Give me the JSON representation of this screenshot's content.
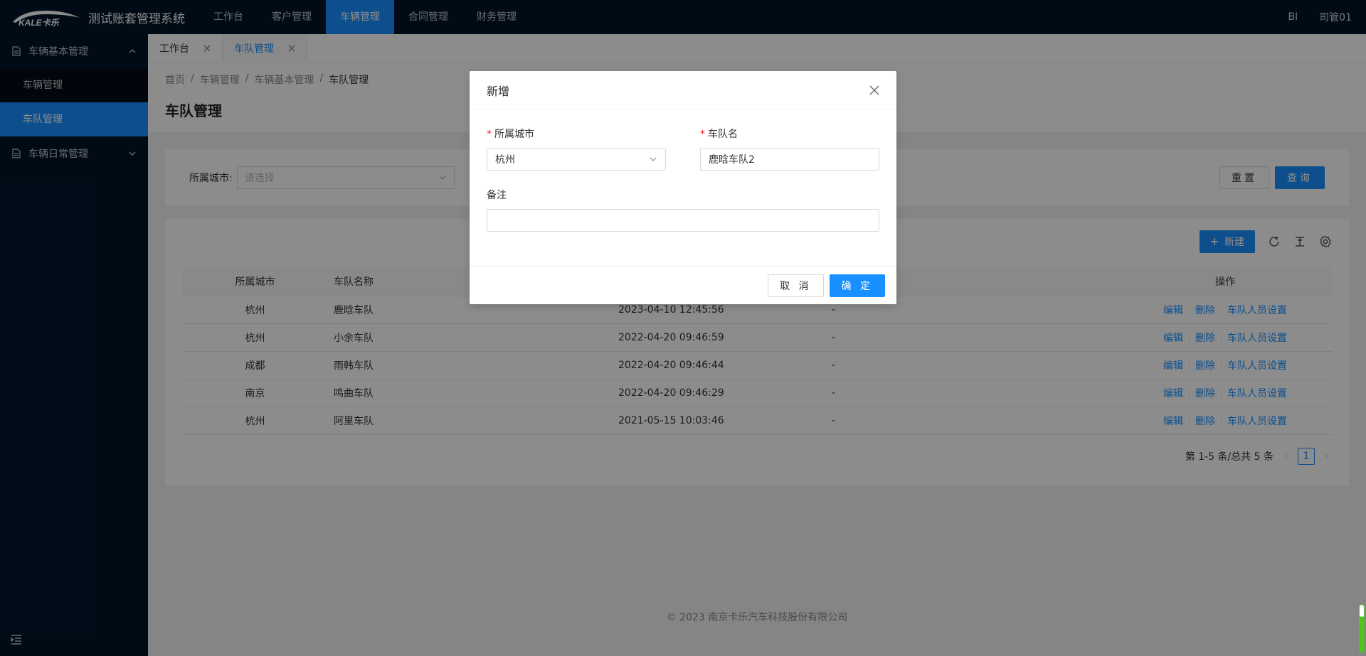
{
  "app": {
    "title": "测试账套管理系统",
    "logo_text": "KALE卡乐",
    "top_nav": [
      "工作台",
      "客户管理",
      "车辆管理",
      "合同管理",
      "财务管理"
    ],
    "top_nav_active": "车辆管理",
    "right_bi": "BI",
    "user": "司管01"
  },
  "sidebar": {
    "group1": "车辆基本管理",
    "group1_items": [
      "车辆管理",
      "车队管理"
    ],
    "active_item": "车队管理",
    "group2": "车辆日常管理"
  },
  "tabs": [
    "工作台",
    "车队管理"
  ],
  "active_tab": "车队管理",
  "breadcrumb": [
    "首页",
    "车辆管理",
    "车辆基本管理",
    "车队管理"
  ],
  "page_title": "车队管理",
  "search": {
    "city_label": "所属城市:",
    "city_placeholder": "请选择",
    "reset_label": "重置",
    "query_label": "查询"
  },
  "table": {
    "new_label": "新建",
    "columns": [
      "所属城市",
      "车队名称",
      "",
      "",
      "操作"
    ],
    "rows": [
      {
        "city": "杭州",
        "name": "鹿晗车队",
        "time": "2023-04-10 12:45:56",
        "remark": "-"
      },
      {
        "city": "杭州",
        "name": "小余车队",
        "time": "2022-04-20 09:46:59",
        "remark": "-"
      },
      {
        "city": "成都",
        "name": "雨韩车队",
        "time": "2022-04-20 09:46:44",
        "remark": "-"
      },
      {
        "city": "南京",
        "name": "鸣曲车队",
        "time": "2022-04-20 09:46:29",
        "remark": "-"
      },
      {
        "city": "杭州",
        "name": "阿里车队",
        "time": "2021-05-15 10:03:46",
        "remark": "-"
      }
    ],
    "ops": {
      "edit": "编辑",
      "delete": "删除",
      "members": "车队人员设置"
    },
    "pagination_text": "第 1-5 条/总共 5 条",
    "current_page": "1"
  },
  "footer": "2023 南京卡乐汽车科技股份有限公司",
  "modal": {
    "title": "新增",
    "city_label": "所属城市",
    "city_value": "杭州",
    "team_label": "车队名",
    "team_value": "鹿晗车队2",
    "remark_label": "备注",
    "remark_value": "",
    "cancel_label": "取 消",
    "ok_label": "确 定"
  },
  "colors": {
    "header_bg": "#001529",
    "primary": "#1890ff",
    "required": "#f5222d"
  }
}
